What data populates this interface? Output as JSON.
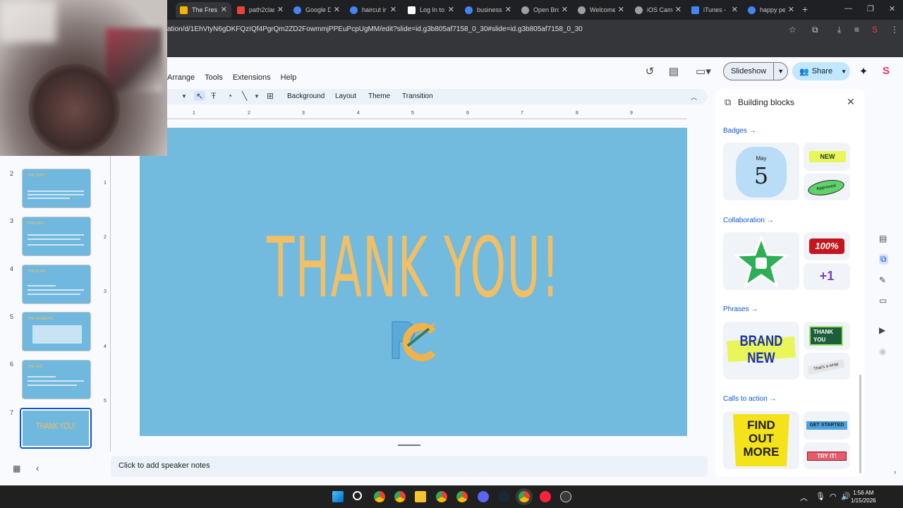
{
  "browser": {
    "tabs": [
      {
        "title": "The Fresh",
        "color": "#f4b400",
        "active": true
      },
      {
        "title": "path2clar",
        "color": "#ea4335"
      },
      {
        "title": "Google D",
        "color": "#4285f4"
      },
      {
        "title": "haircut ir",
        "color": "#4285f4"
      },
      {
        "title": "Log In to",
        "color": "#ffffff"
      },
      {
        "title": "business",
        "color": "#4285f4"
      },
      {
        "title": "Open Bro",
        "color": "#9aa0a6"
      },
      {
        "title": "Welcome",
        "color": "#9aa0a6"
      },
      {
        "title": "iOS Cam",
        "color": "#9aa0a6"
      },
      {
        "title": "iTunes -",
        "color": "#4285f4"
      },
      {
        "title": "happy pe",
        "color": "#4285f4"
      }
    ],
    "url": "ation/d/1EhVtyN6gDKFQzIQf4PgrQm2ZD2FowmmjPPEuPcpUgMM/edit?slide=id.g3b805af7158_0_30#slide=id.g3b805af7158_0_30"
  },
  "menu": [
    "Arrange",
    "Tools",
    "Extensions",
    "Help"
  ],
  "header": {
    "slideshow_label": "Slideshow",
    "share_label": "Share"
  },
  "toolbar": {
    "background": "Background",
    "layout": "Layout",
    "theme": "Theme",
    "transition": "Transition"
  },
  "ruler": [
    "1",
    "2",
    "3",
    "4",
    "5",
    "6",
    "7",
    "8",
    "9"
  ],
  "vruler": [
    "1",
    "2",
    "3",
    "4",
    "5"
  ],
  "slides": [
    {
      "num": "2",
      "title": "THE \"WHY\""
    },
    {
      "num": "3",
      "title": "WHO AM I"
    },
    {
      "num": "4",
      "title": "THE PLAN"
    },
    {
      "num": "5",
      "title": "THE NUMBERS"
    },
    {
      "num": "6",
      "title": "THE ASK"
    },
    {
      "num": "7",
      "title": "THANK YOU!"
    }
  ],
  "slide": {
    "title": "THANK YOU!",
    "logo_text": "PC"
  },
  "notes_placeholder": "Click to add speaker notes",
  "panel": {
    "title": "Building blocks",
    "sections": [
      "Badges",
      "Collaboration",
      "Phrases",
      "Calls to action"
    ],
    "badges": {
      "month": "May",
      "day": "5",
      "new": "NEW",
      "approved": "Approved"
    },
    "collab": {
      "percent": "100%",
      "plus": "+1"
    },
    "phrases": {
      "brand1": "BRAND",
      "brand2": "NEW",
      "thanks1": "THANK",
      "thanks2": "YOU",
      "wrap": "That's a wrap"
    },
    "cta": {
      "find1": "FIND",
      "find2": "OUT",
      "find3": "MORE",
      "started": "GET STARTED",
      "try": "TRY IT!"
    }
  },
  "taskbar": {
    "time": "1:56 AM",
    "date": "1/15/2026"
  }
}
